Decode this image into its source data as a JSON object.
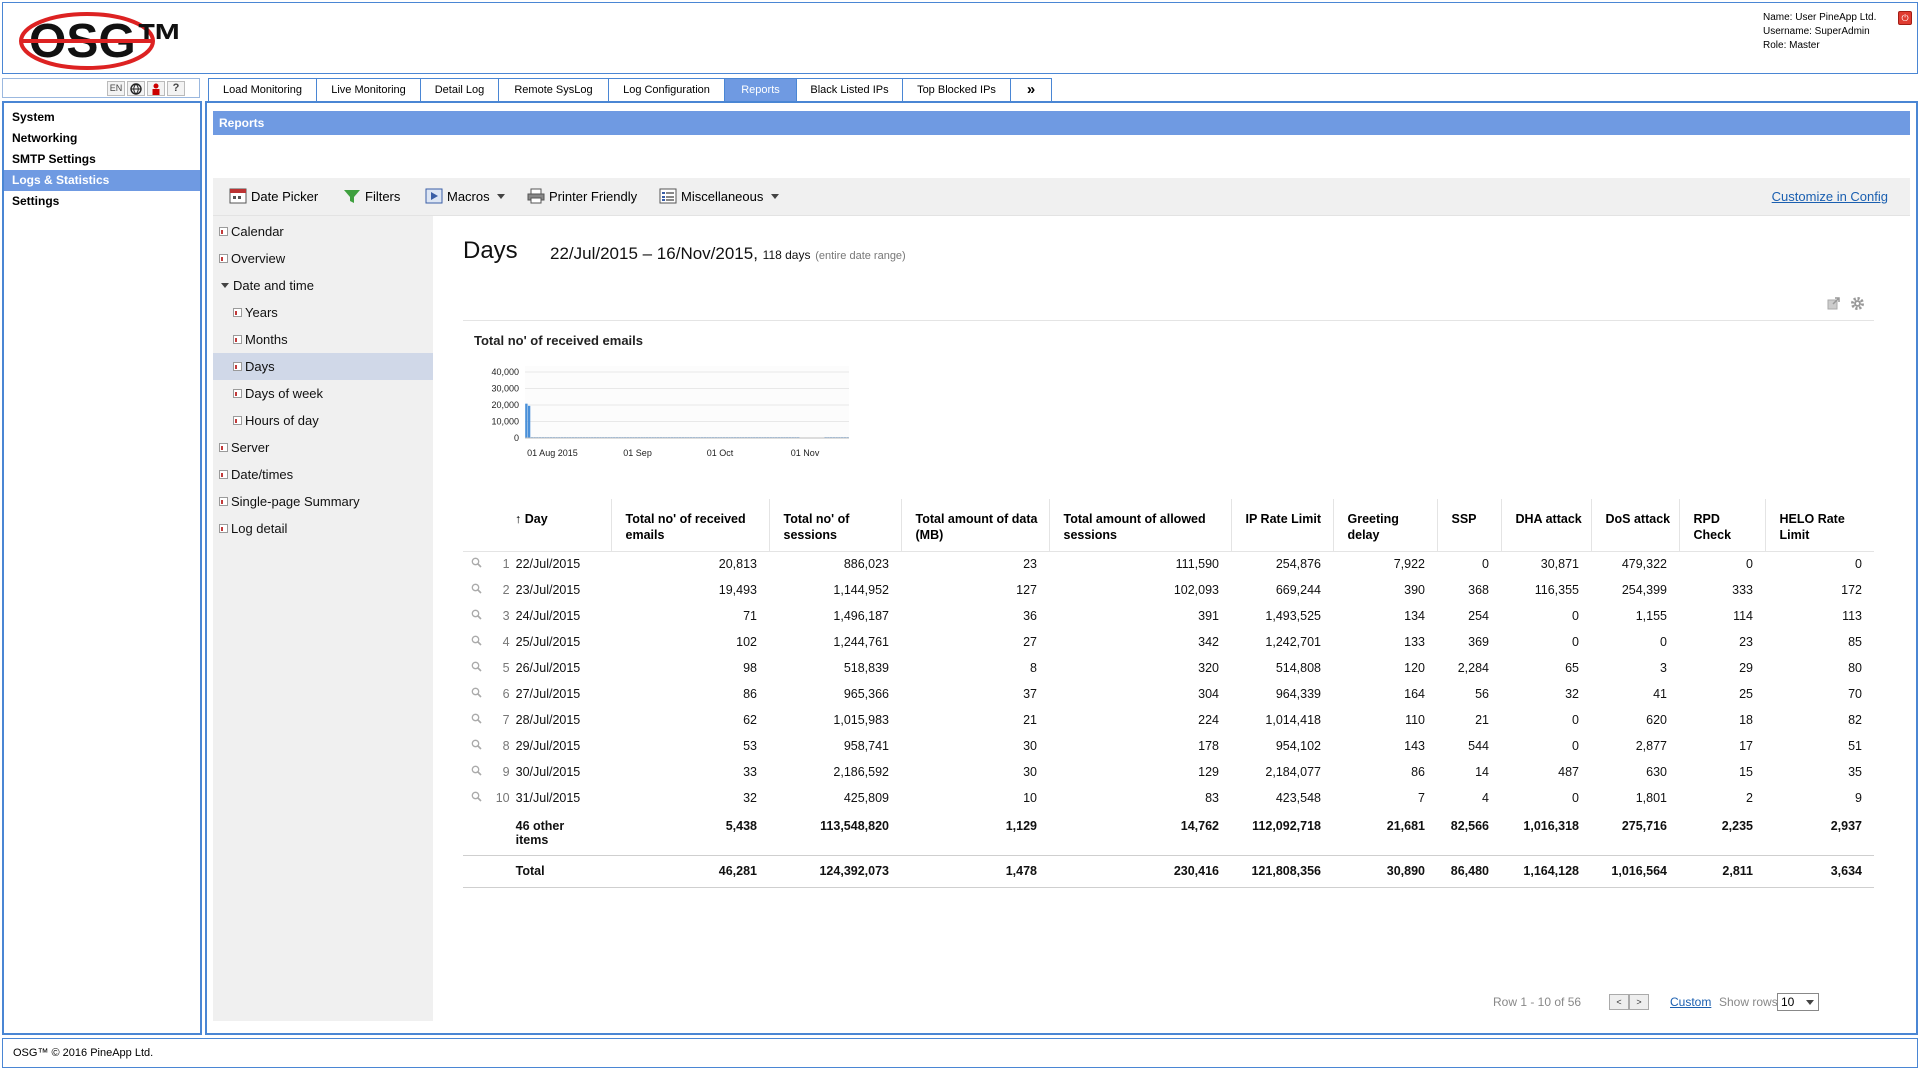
{
  "header": {
    "logo_text": "OSG™",
    "user_name_line": "Name: User PineApp Ltd.",
    "username_line": "Username: SuperAdmin",
    "role_line": "Role: Master",
    "logout_icon": "power-icon"
  },
  "lang_bar": {
    "lang": "EN",
    "help": "?"
  },
  "tabs": [
    {
      "label": "Load Monitoring"
    },
    {
      "label": "Live Monitoring"
    },
    {
      "label": "Detail Log"
    },
    {
      "label": "Remote SysLog"
    },
    {
      "label": "Log Configuration"
    },
    {
      "label": "Reports"
    },
    {
      "label": "Black Listed IPs"
    },
    {
      "label": "Top Blocked IPs"
    },
    {
      "label": "»"
    }
  ],
  "sidebar": {
    "items": [
      {
        "label": "System"
      },
      {
        "label": "Networking"
      },
      {
        "label": "SMTP Settings"
      },
      {
        "label": "Logs & Statistics"
      },
      {
        "label": "Settings"
      }
    ]
  },
  "reports_bar": {
    "title": "Reports"
  },
  "toolbar": {
    "date_picker": "Date Picker",
    "filters": "Filters",
    "macros": "Macros",
    "printer_friendly": "Printer Friendly",
    "miscellaneous": "Miscellaneous",
    "customize": "Customize in Config"
  },
  "report_nav": {
    "calendar": "Calendar",
    "overview": "Overview",
    "date_and_time": "Date and time",
    "years": "Years",
    "months": "Months",
    "days": "Days",
    "days_of_week": "Days of week",
    "hours_of_day": "Hours of day",
    "server": "Server",
    "date_times": "Date/times",
    "single_page_summary": "Single-page Summary",
    "log_detail": "Log detail"
  },
  "content": {
    "title": "Days",
    "date_range": "22/Jul/2015 – 16/Nov/2015,",
    "days_count": "118 days",
    "range_note": "(entire date range)"
  },
  "chart_data": {
    "type": "bar",
    "title": "Total no' of received emails",
    "xlabel": "",
    "ylabel": "",
    "ylim": [
      0,
      40000
    ],
    "y_ticks": [
      "40,000",
      "30,000",
      "20,000",
      "10,000",
      "0"
    ],
    "x_ticks": [
      {
        "label": "01 Aug 2015",
        "day_index": 10
      },
      {
        "label": "01 Sep",
        "day_index": 41
      },
      {
        "label": "01 Oct",
        "day_index": 71
      },
      {
        "label": "01 Nov",
        "day_index": 102
      }
    ],
    "x_count": 118,
    "values": [
      20813,
      19493,
      71,
      102,
      98,
      86,
      62,
      53,
      33,
      32,
      40,
      35,
      30,
      28,
      25,
      300,
      30,
      25,
      20,
      22,
      20,
      18,
      15,
      14,
      16,
      12,
      10,
      12,
      11,
      10,
      9,
      10,
      8,
      9,
      8,
      7,
      8,
      6,
      7,
      6,
      6,
      5,
      6,
      5,
      5,
      4,
      5,
      4,
      4,
      5,
      4,
      4,
      3,
      4,
      4,
      3,
      80,
      90,
      85,
      95,
      88,
      92,
      86,
      90,
      84,
      88,
      82,
      86,
      80,
      84,
      78,
      82,
      80,
      84,
      78,
      80,
      76,
      80,
      78,
      82,
      80,
      78,
      76,
      80,
      74,
      78,
      76,
      72,
      76,
      74,
      70,
      74,
      72,
      70,
      68,
      72,
      70,
      68,
      66,
      70,
      0,
      0,
      0,
      0,
      0,
      0,
      0,
      0,
      0,
      60,
      80,
      90,
      70,
      60,
      50,
      70,
      60,
      50
    ],
    "color": "#4a90d9"
  },
  "table": {
    "headers": {
      "day": "Day",
      "received": "Total no' of received emails",
      "sessions": "Total no' of sessions",
      "data_mb": "Total amount of data (MB)",
      "allowed": "Total amount of allowed sessions",
      "ip_rate": "IP Rate Limit",
      "greeting": "Greeting delay",
      "ssp": "SSP",
      "dha": "DHA attack",
      "dos": "DoS attack",
      "rpd": "RPD Check",
      "helo": "HELO Rate Limit"
    },
    "rows": [
      {
        "idx": "1",
        "day": "22/Jul/2015",
        "received": "20,813",
        "sessions": "886,023",
        "data_mb": "23",
        "allowed": "111,590",
        "ip_rate": "254,876",
        "greeting": "7,922",
        "ssp": "0",
        "dha": "30,871",
        "dos": "479,322",
        "rpd": "0",
        "helo": "0"
      },
      {
        "idx": "2",
        "day": "23/Jul/2015",
        "received": "19,493",
        "sessions": "1,144,952",
        "data_mb": "127",
        "allowed": "102,093",
        "ip_rate": "669,244",
        "greeting": "390",
        "ssp": "368",
        "dha": "116,355",
        "dos": "254,399",
        "rpd": "333",
        "helo": "172"
      },
      {
        "idx": "3",
        "day": "24/Jul/2015",
        "received": "71",
        "sessions": "1,496,187",
        "data_mb": "36",
        "allowed": "391",
        "ip_rate": "1,493,525",
        "greeting": "134",
        "ssp": "254",
        "dha": "0",
        "dos": "1,155",
        "rpd": "114",
        "helo": "113"
      },
      {
        "idx": "4",
        "day": "25/Jul/2015",
        "received": "102",
        "sessions": "1,244,761",
        "data_mb": "27",
        "allowed": "342",
        "ip_rate": "1,242,701",
        "greeting": "133",
        "ssp": "369",
        "dha": "0",
        "dos": "0",
        "rpd": "23",
        "helo": "85"
      },
      {
        "idx": "5",
        "day": "26/Jul/2015",
        "received": "98",
        "sessions": "518,839",
        "data_mb": "8",
        "allowed": "320",
        "ip_rate": "514,808",
        "greeting": "120",
        "ssp": "2,284",
        "dha": "65",
        "dos": "3",
        "rpd": "29",
        "helo": "80"
      },
      {
        "idx": "6",
        "day": "27/Jul/2015",
        "received": "86",
        "sessions": "965,366",
        "data_mb": "37",
        "allowed": "304",
        "ip_rate": "964,339",
        "greeting": "164",
        "ssp": "56",
        "dha": "32",
        "dos": "41",
        "rpd": "25",
        "helo": "70"
      },
      {
        "idx": "7",
        "day": "28/Jul/2015",
        "received": "62",
        "sessions": "1,015,983",
        "data_mb": "21",
        "allowed": "224",
        "ip_rate": "1,014,418",
        "greeting": "110",
        "ssp": "21",
        "dha": "0",
        "dos": "620",
        "rpd": "18",
        "helo": "82"
      },
      {
        "idx": "8",
        "day": "29/Jul/2015",
        "received": "53",
        "sessions": "958,741",
        "data_mb": "30",
        "allowed": "178",
        "ip_rate": "954,102",
        "greeting": "143",
        "ssp": "544",
        "dha": "0",
        "dos": "2,877",
        "rpd": "17",
        "helo": "51"
      },
      {
        "idx": "9",
        "day": "30/Jul/2015",
        "received": "33",
        "sessions": "2,186,592",
        "data_mb": "30",
        "allowed": "129",
        "ip_rate": "2,184,077",
        "greeting": "86",
        "ssp": "14",
        "dha": "487",
        "dos": "630",
        "rpd": "15",
        "helo": "35"
      },
      {
        "idx": "10",
        "day": "31/Jul/2015",
        "received": "32",
        "sessions": "425,809",
        "data_mb": "10",
        "allowed": "83",
        "ip_rate": "423,548",
        "greeting": "7",
        "ssp": "4",
        "dha": "0",
        "dos": "1,801",
        "rpd": "2",
        "helo": "9"
      }
    ],
    "other": {
      "day": "46 other items",
      "received": "5,438",
      "sessions": "113,548,820",
      "data_mb": "1,129",
      "allowed": "14,762",
      "ip_rate": "112,092,718",
      "greeting": "21,681",
      "ssp": "82,566",
      "dha": "1,016,318",
      "dos": "275,716",
      "rpd": "2,235",
      "helo": "2,937"
    },
    "total": {
      "day": "Total",
      "received": "46,281",
      "sessions": "124,392,073",
      "data_mb": "1,478",
      "allowed": "230,416",
      "ip_rate": "121,808,356",
      "greeting": "30,890",
      "ssp": "86,480",
      "dha": "1,164,128",
      "dos": "1,016,564",
      "rpd": "2,811",
      "helo": "3,634"
    }
  },
  "pager": {
    "range_text": "Row 1 - 10 of 56",
    "prev": "<",
    "next": ">",
    "custom": "Custom",
    "show_rows": "Show rows:",
    "rows_value": "10"
  },
  "footer": {
    "text": "OSG™ © 2016 PineApp Ltd."
  }
}
